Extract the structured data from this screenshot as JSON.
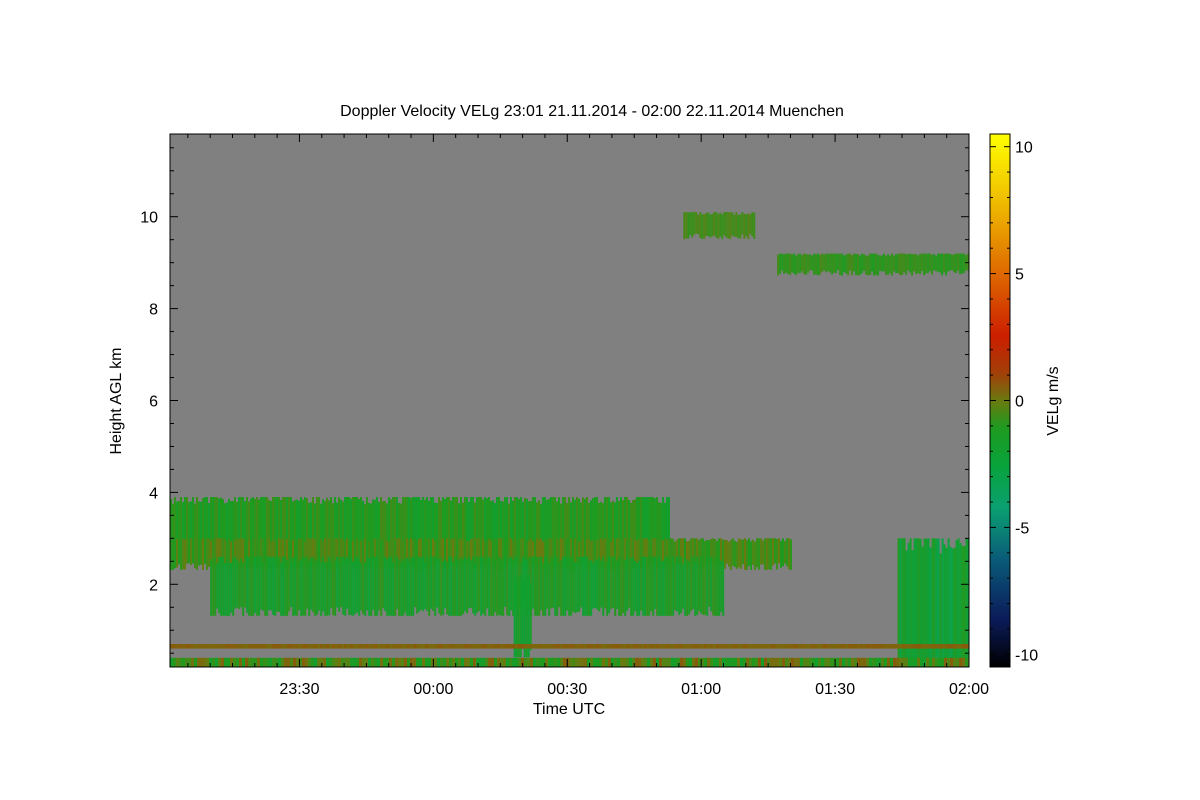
{
  "chart_data": {
    "type": "heatmap",
    "title": "Doppler Velocity VELg   23:01 21.11.2014 - 02:00 22.11.2014 Muenchen",
    "xlabel": "Time UTC",
    "ylabel": "Height AGL km",
    "colorbar_label": "VELg m/s",
    "x_range": [
      "23:01",
      "02:00"
    ],
    "x_ticks": [
      "23:30",
      "00:00",
      "00:30",
      "01:00",
      "01:30",
      "02:00"
    ],
    "y_range": [
      0.2,
      11.8
    ],
    "y_ticks": [
      2,
      4,
      6,
      8,
      10
    ],
    "color_range": [
      -10.5,
      10.5
    ],
    "color_ticks": [
      10,
      5,
      0,
      -5,
      -10
    ],
    "background_color": "#808080",
    "colormap": [
      "#000000",
      "#0b1b5a",
      "#0a5a78",
      "#0aa070",
      "#09a33a",
      "#1f9a1f",
      "#6b7a10",
      "#a04008",
      "#cc1e00",
      "#e07000",
      "#f0c000",
      "#ffff00"
    ],
    "features": [
      {
        "name": "low cloud layer (top)",
        "t_start": "23:01",
        "t_end": "00:53",
        "h_bottom": 2.7,
        "h_top": 3.9,
        "velocity_range": [
          -2,
          0
        ]
      },
      {
        "name": "low cloud layer (middle)",
        "t_start": "23:01",
        "t_end": "01:20",
        "h_bottom": 2.4,
        "h_top": 3.0,
        "velocity_range": [
          -1,
          1
        ]
      },
      {
        "name": "falling streaks",
        "t_start": "23:10",
        "t_end": "01:05",
        "h_bottom": 1.4,
        "h_top": 2.6,
        "velocity_range": [
          -2.5,
          -0.5
        ]
      },
      {
        "name": "fall streak",
        "t_start": "00:18",
        "t_end": "00:22",
        "h_bottom": 0.5,
        "h_top": 2.2,
        "velocity_range": [
          -2.5,
          -1
        ]
      },
      {
        "name": "upper cloud",
        "t_start": "00:56",
        "t_end": "01:12",
        "h_bottom": 9.6,
        "h_top": 10.1,
        "velocity_range": [
          -0.5,
          0.5
        ]
      },
      {
        "name": "cirrus layer",
        "t_start": "01:17",
        "t_end": "02:00",
        "h_bottom": 8.8,
        "h_top": 9.2,
        "velocity_range": [
          -1,
          0
        ]
      },
      {
        "name": "precipitation",
        "t_start": "01:44",
        "t_end": "02:00",
        "h_bottom": 0.2,
        "h_top": 3.0,
        "velocity_range": [
          -3.5,
          -1
        ]
      },
      {
        "name": "surface clutter (red line)",
        "t_start": "23:01",
        "t_end": "02:00",
        "h_bottom": 0.6,
        "h_top": 0.7,
        "velocity_range": [
          1.5,
          2
        ]
      },
      {
        "name": "surface clutter",
        "t_start": "23:01",
        "t_end": "02:00",
        "h_bottom": 0.2,
        "h_top": 0.4,
        "velocity_range": [
          -2,
          2
        ]
      }
    ]
  }
}
